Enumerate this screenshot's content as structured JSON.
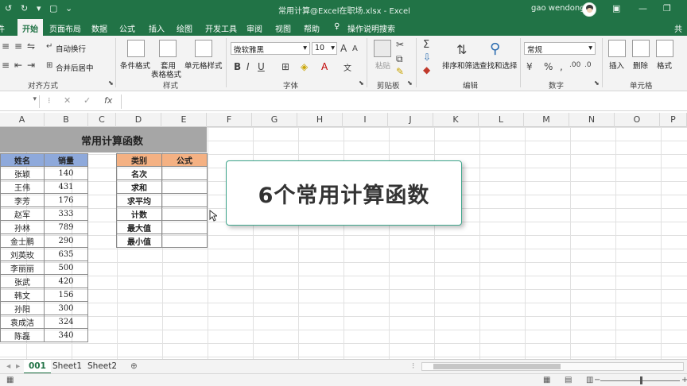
{
  "titlebar": {
    "window_title": "常用计算@Excel在职场.xlsx  -  Excel",
    "user_name": "gao wendong"
  },
  "ribbon_tabs": [
    {
      "id": "left",
      "label": "件"
    },
    {
      "id": "home",
      "label": "开始"
    },
    {
      "id": "layout",
      "label": "页面布局"
    },
    {
      "id": "data",
      "label": "数据"
    },
    {
      "id": "formula",
      "label": "公式"
    },
    {
      "id": "insert",
      "label": "插入"
    },
    {
      "id": "draw",
      "label": "绘图"
    },
    {
      "id": "dev",
      "label": "开发工具"
    },
    {
      "id": "review",
      "label": "审阅"
    },
    {
      "id": "view",
      "label": "视图"
    },
    {
      "id": "help",
      "label": "帮助"
    },
    {
      "id": "tell",
      "label": "操作说明搜索"
    },
    {
      "id": "share",
      "label": "共"
    }
  ],
  "ribbon": {
    "wrap_text": "自动换行",
    "merge_center": "合并后居中",
    "alignment_group": "对齐方式",
    "cond_format": "条件格式",
    "table_format_1": "套用",
    "table_format_2": "表格格式",
    "cell_style": "单元格样式",
    "styles_group": "样式",
    "font_name": "微软雅黑",
    "font_size": "10",
    "font_group": "字体",
    "paste": "粘贴",
    "clipboard_group": "剪贴板",
    "sort_filter": "排序和筛选",
    "find_select": "查找和选择",
    "editing_group": "编辑",
    "number_format": "常规",
    "number_group": "数字",
    "insert": "插入",
    "delete": "删除",
    "format": "格式",
    "cells_group": "单元格"
  },
  "formula_bar": {
    "fx": "fx",
    "value": ""
  },
  "columns": [
    "A",
    "B",
    "C",
    "D",
    "E",
    "F",
    "G",
    "H",
    "I",
    "J",
    "K",
    "L",
    "M",
    "N",
    "O",
    "P"
  ],
  "sheet": {
    "title": "常用计算函数",
    "header_name": "姓名",
    "header_sales": "销量",
    "rows": [
      {
        "name": "张颖",
        "sales": "140"
      },
      {
        "name": "王伟",
        "sales": "431"
      },
      {
        "name": "李芳",
        "sales": "176"
      },
      {
        "name": "赵军",
        "sales": "333"
      },
      {
        "name": "孙林",
        "sales": "789"
      },
      {
        "name": "金士鹏",
        "sales": "290"
      },
      {
        "name": "刘英玫",
        "sales": "635"
      },
      {
        "name": "李丽丽",
        "sales": "500"
      },
      {
        "name": "张武",
        "sales": "420"
      },
      {
        "name": "韩文",
        "sales": "156"
      },
      {
        "name": "孙阳",
        "sales": "300"
      },
      {
        "name": "袁成洁",
        "sales": "324"
      },
      {
        "name": "陈磊",
        "sales": "340"
      }
    ],
    "header_category": "类别",
    "header_formula": "公式",
    "categories": [
      "名次",
      "求和",
      "求平均",
      "计数",
      "最大值",
      "最小值"
    ]
  },
  "callout": "6个常用计算函数",
  "sheet_tabs": [
    "001",
    "Sheet1",
    "Sheet2"
  ],
  "colors": {
    "excel_green": "#217346",
    "title_fill": "#a6a6a6",
    "name_header_fill": "#8ea9db",
    "category_header_fill": "#f4b183",
    "callout_border": "#3da48a"
  }
}
